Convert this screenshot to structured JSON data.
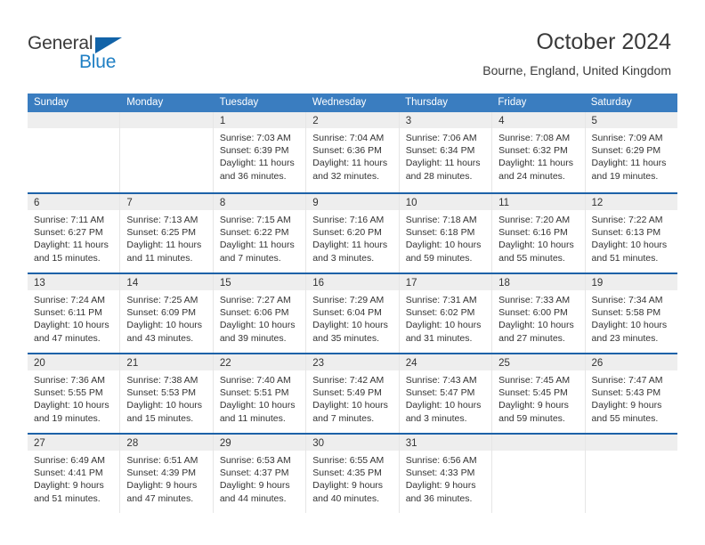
{
  "brand": {
    "name_part1": "General",
    "name_part2": "Blue"
  },
  "header": {
    "title": "October 2024",
    "location": "Bourne, England, United Kingdom"
  },
  "colors": {
    "header_blue": "#3a7dc0",
    "row_separator_blue": "#1d62a8",
    "date_band_gray": "#eeeeee",
    "logo_blue": "#1f7fc4",
    "text": "#333333"
  },
  "weekdays": [
    "Sunday",
    "Monday",
    "Tuesday",
    "Wednesday",
    "Thursday",
    "Friday",
    "Saturday"
  ],
  "weeks": [
    [
      {
        "date": "",
        "lines": []
      },
      {
        "date": "",
        "lines": []
      },
      {
        "date": "1",
        "lines": [
          "Sunrise: 7:03 AM",
          "Sunset: 6:39 PM",
          "Daylight: 11 hours",
          "and 36 minutes."
        ]
      },
      {
        "date": "2",
        "lines": [
          "Sunrise: 7:04 AM",
          "Sunset: 6:36 PM",
          "Daylight: 11 hours",
          "and 32 minutes."
        ]
      },
      {
        "date": "3",
        "lines": [
          "Sunrise: 7:06 AM",
          "Sunset: 6:34 PM",
          "Daylight: 11 hours",
          "and 28 minutes."
        ]
      },
      {
        "date": "4",
        "lines": [
          "Sunrise: 7:08 AM",
          "Sunset: 6:32 PM",
          "Daylight: 11 hours",
          "and 24 minutes."
        ]
      },
      {
        "date": "5",
        "lines": [
          "Sunrise: 7:09 AM",
          "Sunset: 6:29 PM",
          "Daylight: 11 hours",
          "and 19 minutes."
        ]
      }
    ],
    [
      {
        "date": "6",
        "lines": [
          "Sunrise: 7:11 AM",
          "Sunset: 6:27 PM",
          "Daylight: 11 hours",
          "and 15 minutes."
        ]
      },
      {
        "date": "7",
        "lines": [
          "Sunrise: 7:13 AM",
          "Sunset: 6:25 PM",
          "Daylight: 11 hours",
          "and 11 minutes."
        ]
      },
      {
        "date": "8",
        "lines": [
          "Sunrise: 7:15 AM",
          "Sunset: 6:22 PM",
          "Daylight: 11 hours",
          "and 7 minutes."
        ]
      },
      {
        "date": "9",
        "lines": [
          "Sunrise: 7:16 AM",
          "Sunset: 6:20 PM",
          "Daylight: 11 hours",
          "and 3 minutes."
        ]
      },
      {
        "date": "10",
        "lines": [
          "Sunrise: 7:18 AM",
          "Sunset: 6:18 PM",
          "Daylight: 10 hours",
          "and 59 minutes."
        ]
      },
      {
        "date": "11",
        "lines": [
          "Sunrise: 7:20 AM",
          "Sunset: 6:16 PM",
          "Daylight: 10 hours",
          "and 55 minutes."
        ]
      },
      {
        "date": "12",
        "lines": [
          "Sunrise: 7:22 AM",
          "Sunset: 6:13 PM",
          "Daylight: 10 hours",
          "and 51 minutes."
        ]
      }
    ],
    [
      {
        "date": "13",
        "lines": [
          "Sunrise: 7:24 AM",
          "Sunset: 6:11 PM",
          "Daylight: 10 hours",
          "and 47 minutes."
        ]
      },
      {
        "date": "14",
        "lines": [
          "Sunrise: 7:25 AM",
          "Sunset: 6:09 PM",
          "Daylight: 10 hours",
          "and 43 minutes."
        ]
      },
      {
        "date": "15",
        "lines": [
          "Sunrise: 7:27 AM",
          "Sunset: 6:06 PM",
          "Daylight: 10 hours",
          "and 39 minutes."
        ]
      },
      {
        "date": "16",
        "lines": [
          "Sunrise: 7:29 AM",
          "Sunset: 6:04 PM",
          "Daylight: 10 hours",
          "and 35 minutes."
        ]
      },
      {
        "date": "17",
        "lines": [
          "Sunrise: 7:31 AM",
          "Sunset: 6:02 PM",
          "Daylight: 10 hours",
          "and 31 minutes."
        ]
      },
      {
        "date": "18",
        "lines": [
          "Sunrise: 7:33 AM",
          "Sunset: 6:00 PM",
          "Daylight: 10 hours",
          "and 27 minutes."
        ]
      },
      {
        "date": "19",
        "lines": [
          "Sunrise: 7:34 AM",
          "Sunset: 5:58 PM",
          "Daylight: 10 hours",
          "and 23 minutes."
        ]
      }
    ],
    [
      {
        "date": "20",
        "lines": [
          "Sunrise: 7:36 AM",
          "Sunset: 5:55 PM",
          "Daylight: 10 hours",
          "and 19 minutes."
        ]
      },
      {
        "date": "21",
        "lines": [
          "Sunrise: 7:38 AM",
          "Sunset: 5:53 PM",
          "Daylight: 10 hours",
          "and 15 minutes."
        ]
      },
      {
        "date": "22",
        "lines": [
          "Sunrise: 7:40 AM",
          "Sunset: 5:51 PM",
          "Daylight: 10 hours",
          "and 11 minutes."
        ]
      },
      {
        "date": "23",
        "lines": [
          "Sunrise: 7:42 AM",
          "Sunset: 5:49 PM",
          "Daylight: 10 hours",
          "and 7 minutes."
        ]
      },
      {
        "date": "24",
        "lines": [
          "Sunrise: 7:43 AM",
          "Sunset: 5:47 PM",
          "Daylight: 10 hours",
          "and 3 minutes."
        ]
      },
      {
        "date": "25",
        "lines": [
          "Sunrise: 7:45 AM",
          "Sunset: 5:45 PM",
          "Daylight: 9 hours",
          "and 59 minutes."
        ]
      },
      {
        "date": "26",
        "lines": [
          "Sunrise: 7:47 AM",
          "Sunset: 5:43 PM",
          "Daylight: 9 hours",
          "and 55 minutes."
        ]
      }
    ],
    [
      {
        "date": "27",
        "lines": [
          "Sunrise: 6:49 AM",
          "Sunset: 4:41 PM",
          "Daylight: 9 hours",
          "and 51 minutes."
        ]
      },
      {
        "date": "28",
        "lines": [
          "Sunrise: 6:51 AM",
          "Sunset: 4:39 PM",
          "Daylight: 9 hours",
          "and 47 minutes."
        ]
      },
      {
        "date": "29",
        "lines": [
          "Sunrise: 6:53 AM",
          "Sunset: 4:37 PM",
          "Daylight: 9 hours",
          "and 44 minutes."
        ]
      },
      {
        "date": "30",
        "lines": [
          "Sunrise: 6:55 AM",
          "Sunset: 4:35 PM",
          "Daylight: 9 hours",
          "and 40 minutes."
        ]
      },
      {
        "date": "31",
        "lines": [
          "Sunrise: 6:56 AM",
          "Sunset: 4:33 PM",
          "Daylight: 9 hours",
          "and 36 minutes."
        ]
      },
      {
        "date": "",
        "lines": []
      },
      {
        "date": "",
        "lines": []
      }
    ]
  ]
}
